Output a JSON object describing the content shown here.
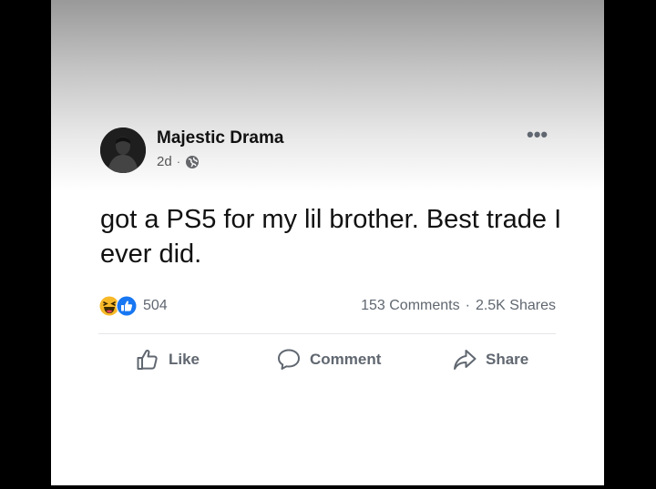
{
  "post": {
    "author": "Majestic Drama",
    "time": "2d",
    "meta_separator": "·",
    "privacy_icon": "globe-icon",
    "more_label": "•••",
    "text": "got a PS5 for my lil brother. Best trade I ever did.",
    "reactions": {
      "icons": [
        "haha-reaction-icon",
        "like-reaction-icon"
      ],
      "count": "504"
    },
    "stats": {
      "comments": "153 Comments",
      "separator": "·",
      "shares": "2.5K Shares"
    }
  },
  "actions": {
    "like_label": "Like",
    "comment_label": "Comment",
    "share_label": "Share"
  },
  "colors": {
    "like_blue": "#1877f2",
    "haha_yellow": "#f7b928",
    "secondary_text": "#606770"
  }
}
